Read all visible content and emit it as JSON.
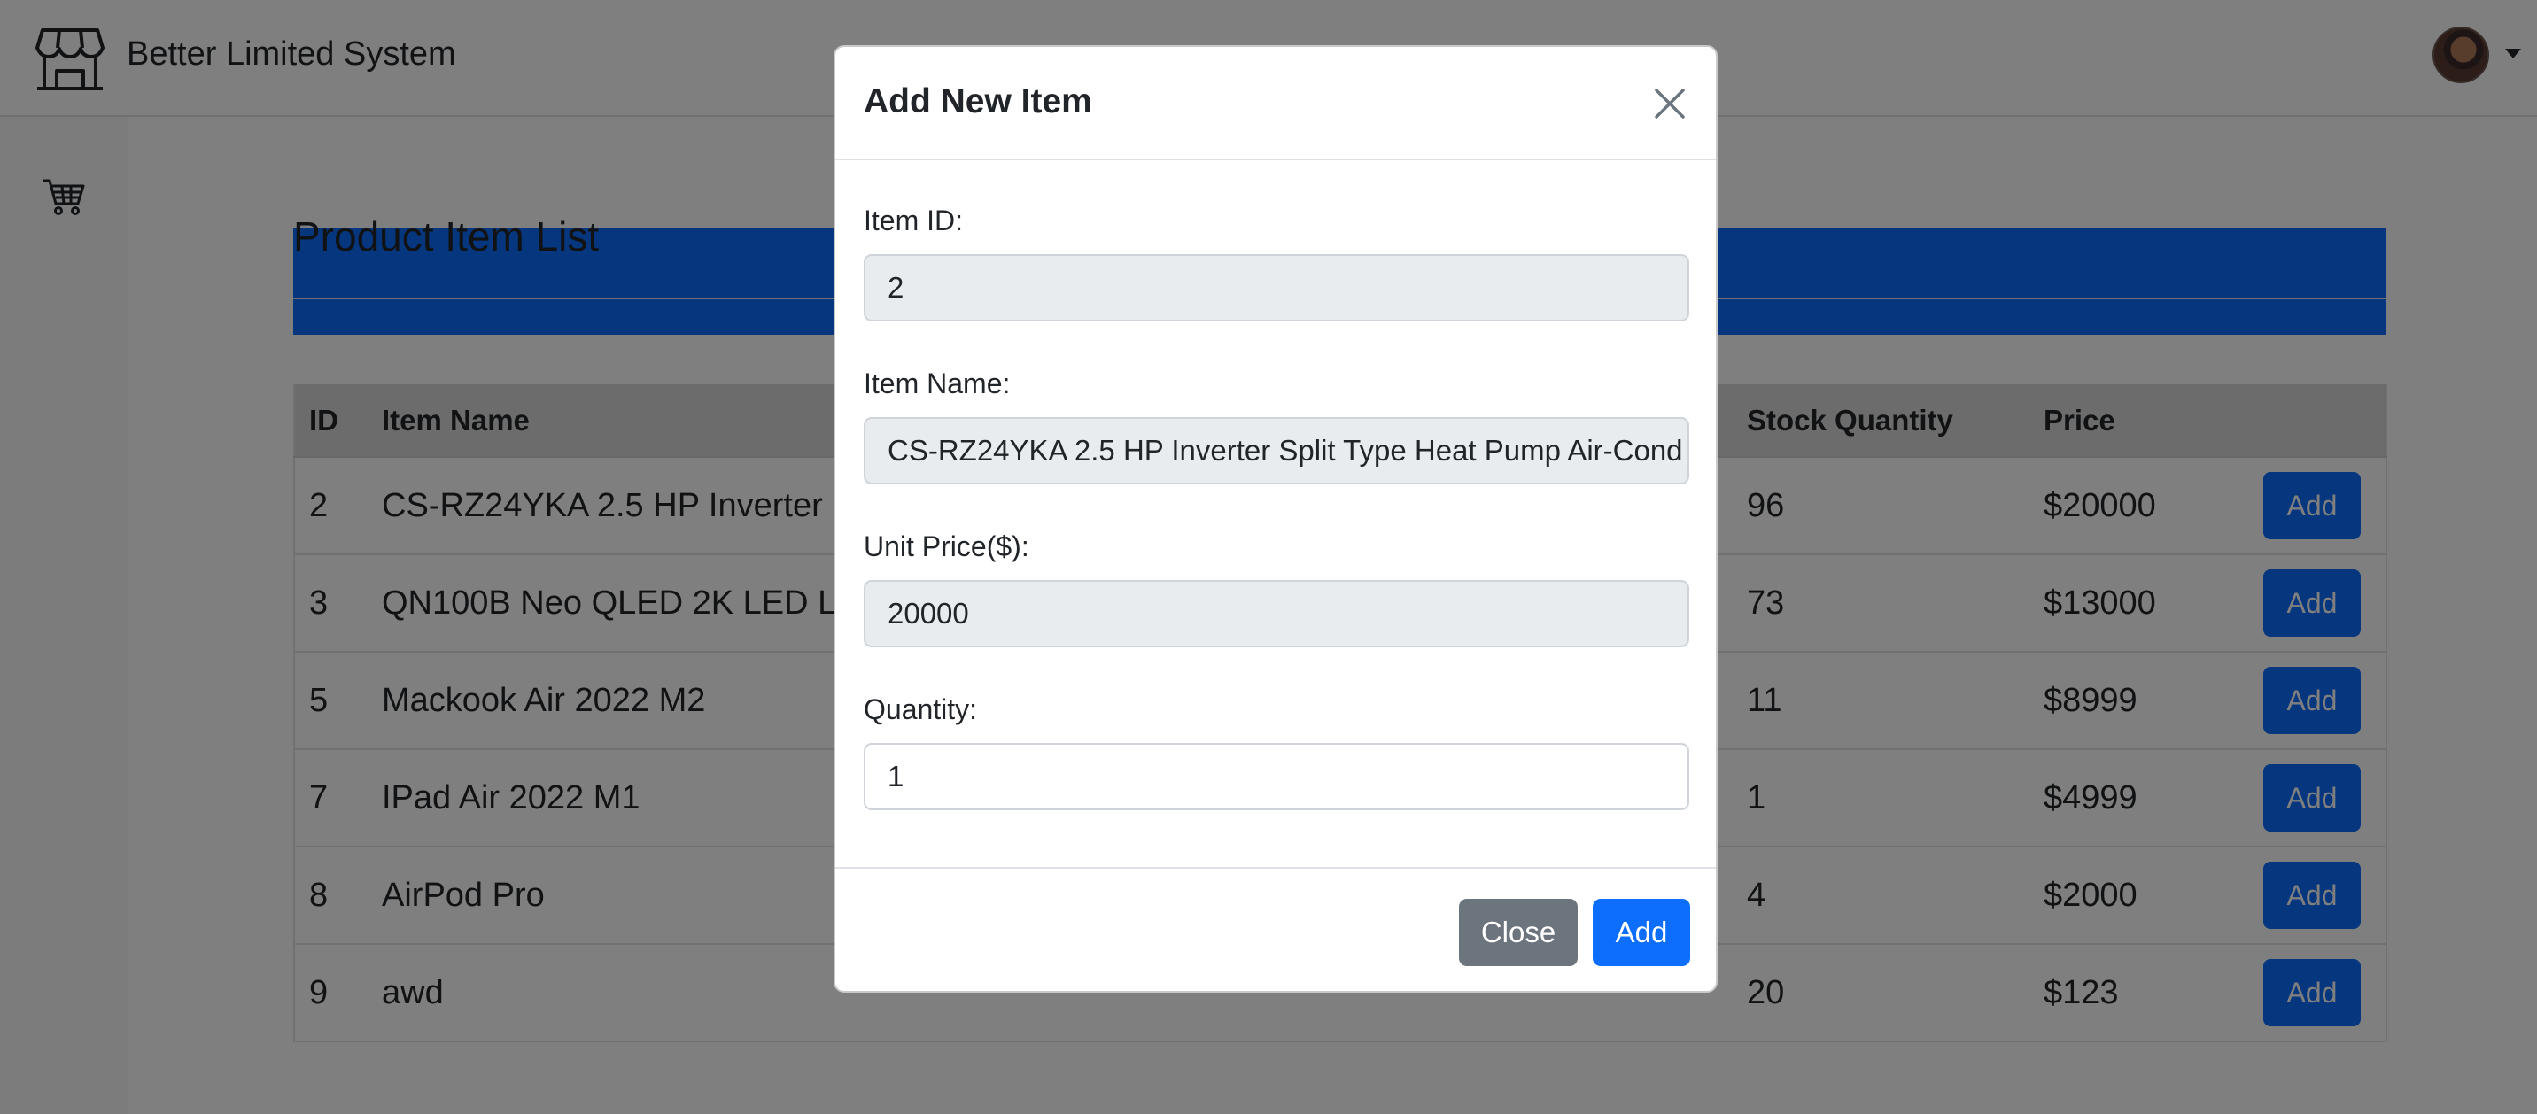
{
  "app": {
    "title": "Better Limited System",
    "brand_icon": "store-icon"
  },
  "sidebar": {
    "items": [
      {
        "icon": "cart-icon"
      },
      {
        "icon": "table-icon",
        "active": true
      }
    ]
  },
  "main": {
    "page_title": "Product Item List"
  },
  "table": {
    "headers": {
      "id": "ID",
      "name": "Item Name",
      "stock": "Stock Quantity",
      "price": "Price"
    },
    "rows": [
      {
        "id": "2",
        "name": "CS-RZ24YKA 2.5 HP Inverter",
        "stock": "96",
        "price": "$20000",
        "action": "Add"
      },
      {
        "id": "3",
        "name": "QN100B Neo QLED 2K LED L",
        "stock": "73",
        "price": "$13000",
        "action": "Add"
      },
      {
        "id": "5",
        "name": "Mackook Air 2022 M2",
        "stock": "11",
        "price": "$8999",
        "action": "Add"
      },
      {
        "id": "7",
        "name": "IPad Air 2022 M1",
        "stock": "1",
        "price": "$4999",
        "action": "Add"
      },
      {
        "id": "8",
        "name": "AirPod Pro",
        "stock": "4",
        "price": "$2000",
        "action": "Add"
      },
      {
        "id": "9",
        "name": "awd",
        "stock": "20",
        "price": "$123",
        "action": "Add"
      }
    ]
  },
  "modal": {
    "title": "Add New Item",
    "fields": {
      "item_id": {
        "label": "Item ID:",
        "value": "2"
      },
      "item_name": {
        "label": "Item Name:",
        "value": "CS-RZ24YKA 2.5 HP Inverter Split Type Heat Pump Air-Cond"
      },
      "unit_price": {
        "label": "Unit Price($):",
        "value": "20000"
      },
      "quantity": {
        "label": "Quantity:",
        "value": "1"
      }
    },
    "close_label": "Close",
    "submit_label": "Add"
  },
  "colors": {
    "primary": "#0d6efd",
    "secondary": "#6c757d"
  }
}
